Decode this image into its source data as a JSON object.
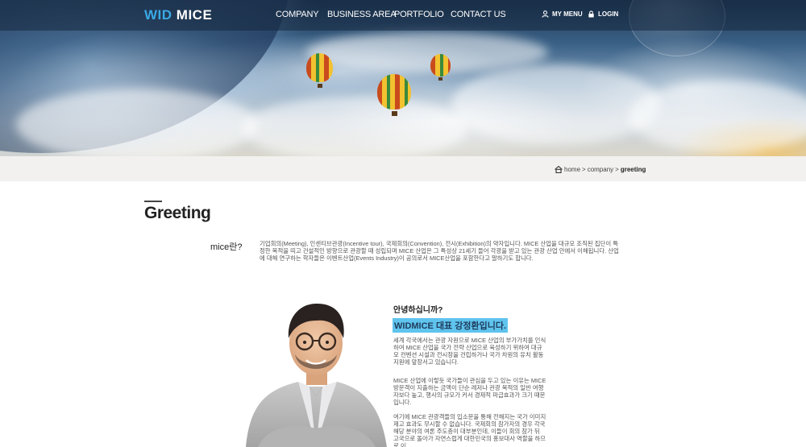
{
  "header": {
    "logo_left": "WID",
    "logo_right": "MICE",
    "nav": [
      "COMPANY",
      "BUSINESS AREA",
      "PORTFOLIO",
      "CONTACT US"
    ],
    "my_menu": "MY MENU",
    "login": "LOGIN"
  },
  "breadcrumb": {
    "home": "home",
    "sep": ">",
    "company": "company",
    "current": "greeting"
  },
  "page": {
    "title": "Greeting",
    "mice_label": "mice란?",
    "mice_text": "기업회의(Meeting), 인센티브관광(Incentive tour), 국제회의(Convention), 전시(Exhibition)의 약자입니다. MICE 산업을 대규모 조직된 집단이 특정한 목적을 띠고 건설적인 방향으로 관광할 때 성립되며 MICE 산업은 그 특성상 21세기 들어 각광을 받고 있는 관광 산업 안에서 이해됩니다. 산업에 대해 연구하는 학자들은 이벤트산업(Events Industry)이 공의로서 MICE산업을 포함한다고 말하기도 합니다.",
    "hello": "안녕하십니까?",
    "ceo": "WIDMICE 대표 강정환입니다.",
    "para1": "세계 각국에서는 관광 자원으로 MICE 산업의 부가가치를 인식하여 MICE 산업을 국가 전략 산업으로 육성하기 위하여 대규모 컨벤션 시설과 전시장을 건립하거나 국가 차원의 유치 활동 지원에 앞장서고 있습니다.",
    "para2": "MICE 산업에 이렇듯 국가들이 관심을 두고 있는 이유는 MICE 방문객이 지출하는 금액이 단순 레저나 관광 목적의 일반 여행자보다 높고, 행사의 규모가 커서 경제적 파급효과가 크기 때문입니다.",
    "para3": "여기에 MICE 관광객들의 입소문을 통해 전해지는 국가 이미지 제고 효과도 무시할 수 없습니다. 국제회의 참가자의 경우 각국 해당 분야의 여론 주도층이 대부분인데, 이들이 회의 참가 뒤 고국으로 돌아가 자연스럽게 대한민국의 홍보대사 역할을 하므로 이"
  },
  "colors": {
    "accent": "#5fc4ee",
    "logo_blue": "#3aa9e6"
  }
}
